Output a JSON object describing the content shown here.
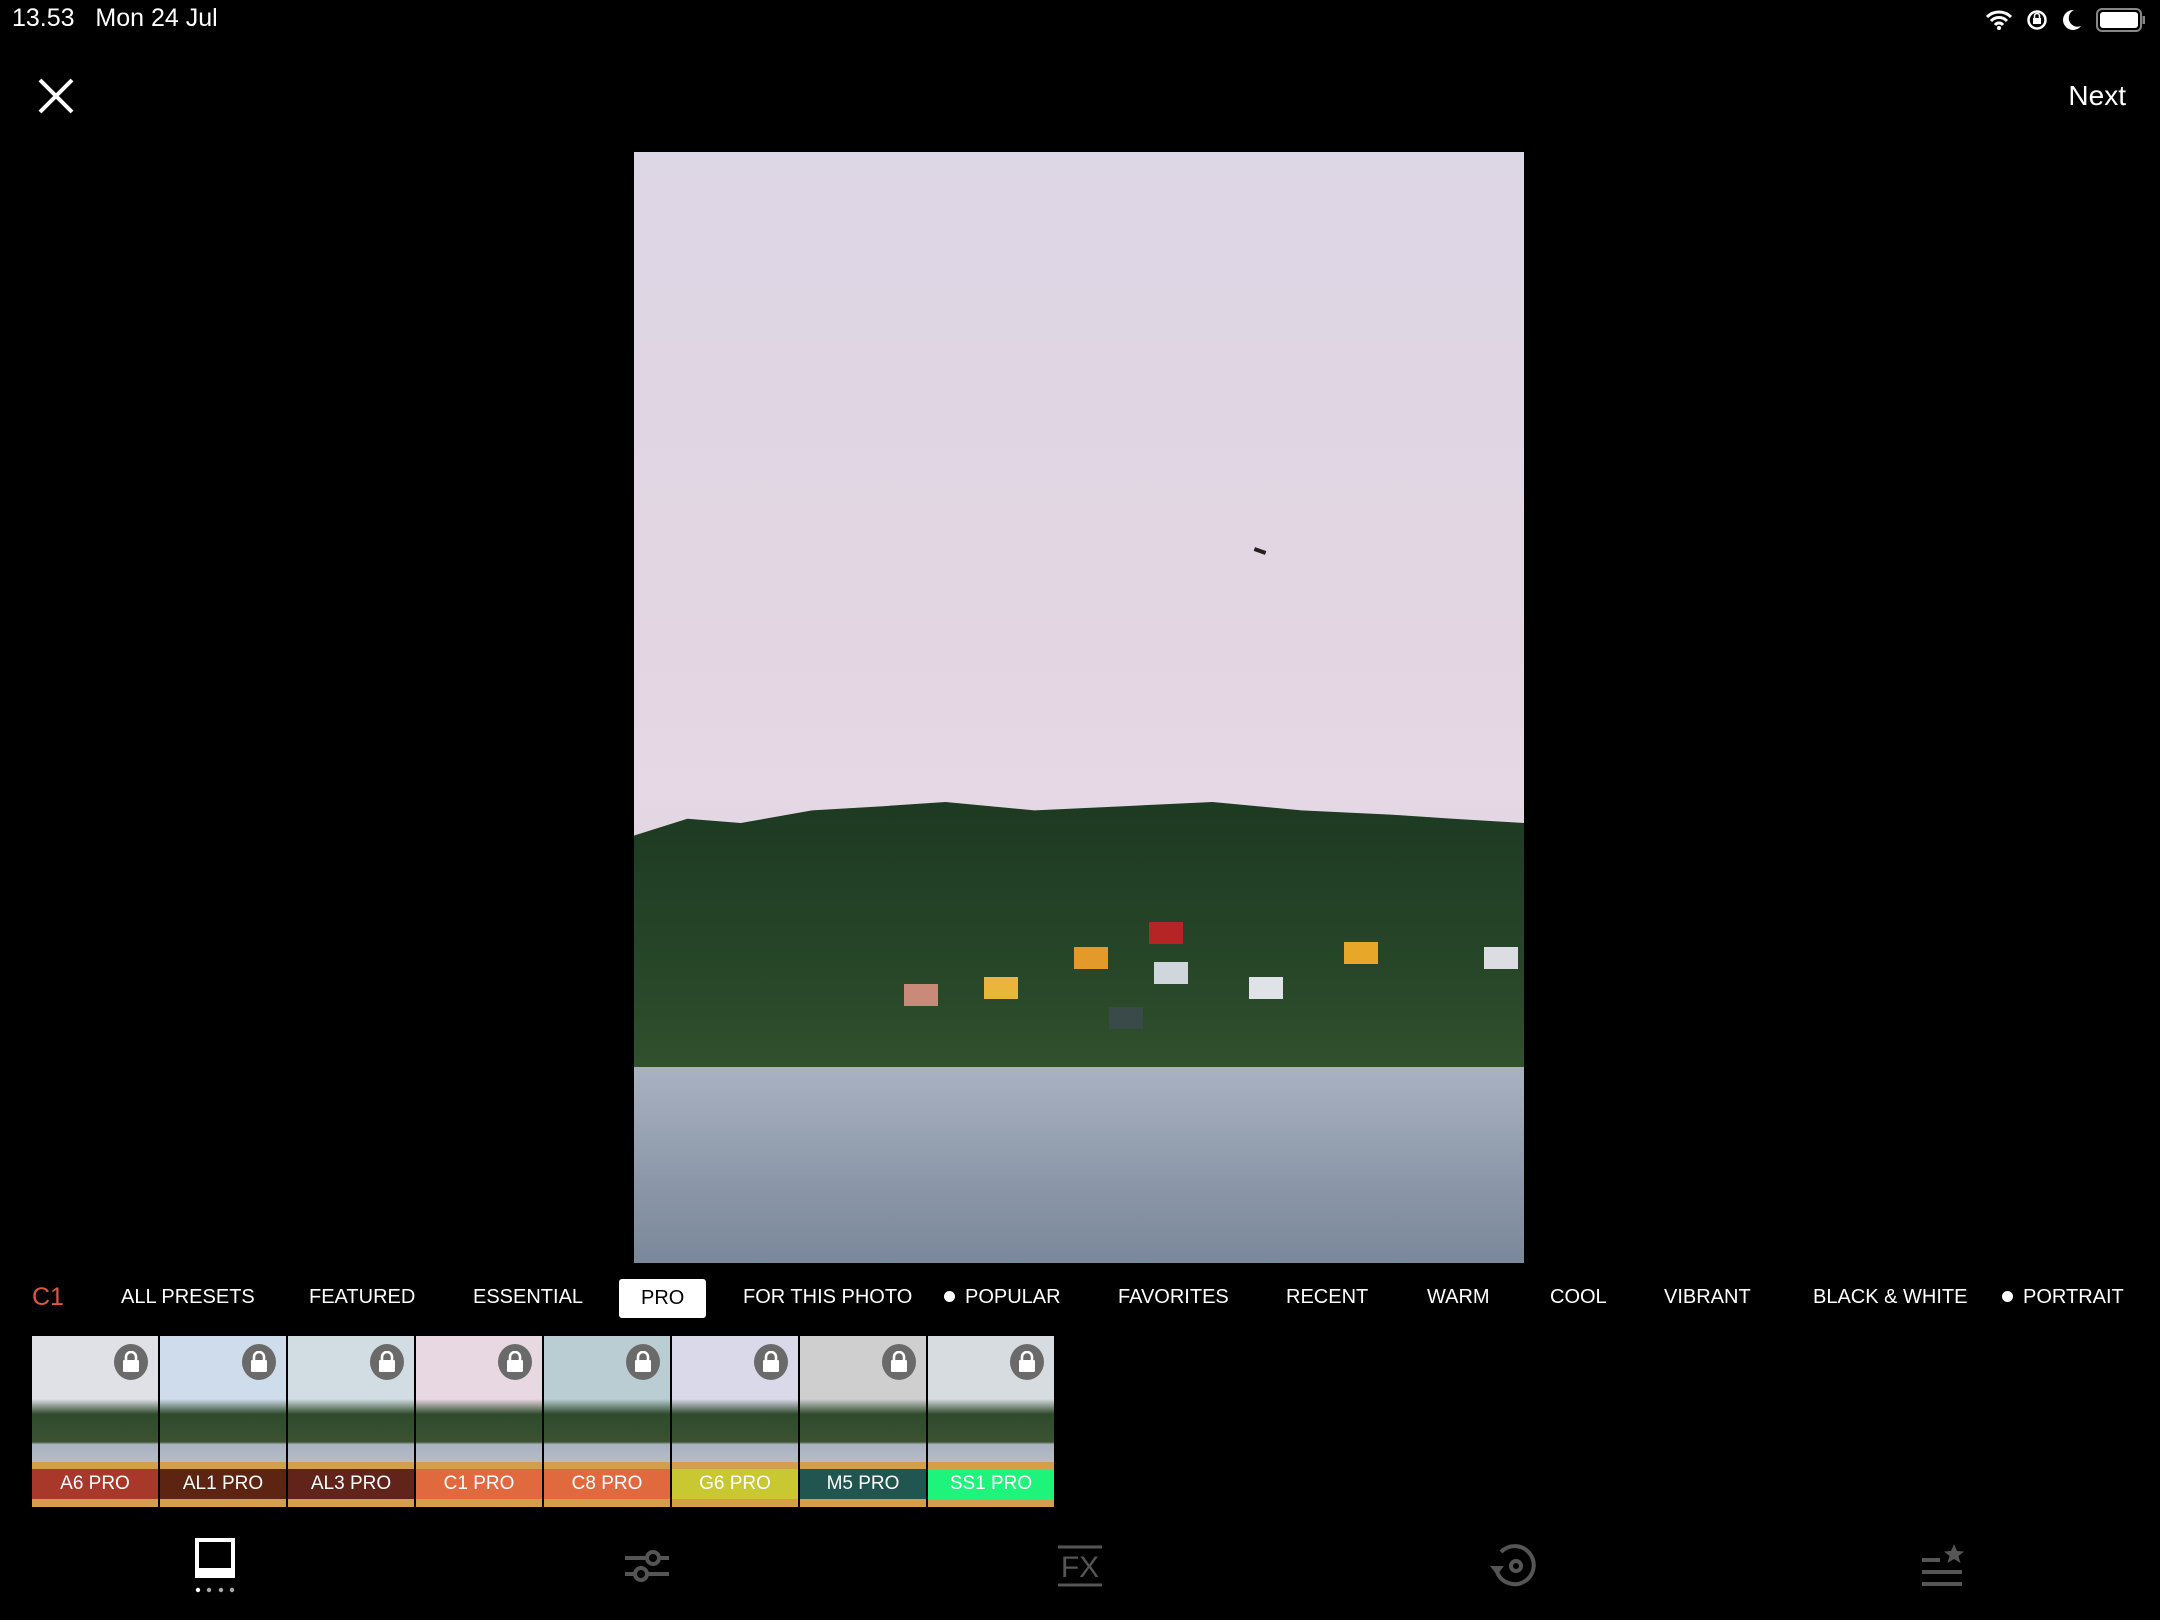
{
  "status_bar": {
    "time": "13.53",
    "date": "Mon 24 Jul",
    "icons": [
      "wifi-icon",
      "rotation-lock-icon",
      "moon-icon",
      "battery-icon"
    ]
  },
  "header": {
    "close_icon": "close-icon",
    "next_label": "Next"
  },
  "categories": {
    "current_preset": "C1",
    "items": [
      {
        "label": "ALL PRESETS"
      },
      {
        "label": "FEATURED"
      },
      {
        "label": "ESSENTIAL"
      },
      {
        "label": "PRO",
        "selected": true
      },
      {
        "label": "FOR THIS PHOTO"
      },
      {
        "label": "POPULAR",
        "dot": true
      },
      {
        "label": "FAVORITES"
      },
      {
        "label": "RECENT"
      },
      {
        "label": "WARM"
      },
      {
        "label": "COOL"
      },
      {
        "label": "VIBRANT"
      },
      {
        "label": "BLACK & WHITE"
      },
      {
        "label": "PORTRAIT",
        "dot": true
      }
    ]
  },
  "presets": [
    {
      "label": "A6 PRO",
      "color": "#a8392a",
      "sky": "#dfe1e6",
      "locked": true
    },
    {
      "label": "AL1 PRO",
      "color": "#5e2412",
      "sky": "#cfdcec",
      "locked": true
    },
    {
      "label": "AL3 PRO",
      "color": "#62241a",
      "sky": "#d2dde3",
      "locked": true
    },
    {
      "label": "C1 PRO",
      "color": "#e0693d",
      "sky": "#e8d8e2",
      "locked": true
    },
    {
      "label": "C8 PRO",
      "color": "#e0693d",
      "sky": "#b9cdd3",
      "locked": true
    },
    {
      "label": "G6 PRO",
      "color": "#c9c832",
      "sky": "#dad9ea",
      "locked": true
    },
    {
      "label": "M5 PRO",
      "color": "#215650",
      "sky": "#cfcfcf",
      "locked": true
    },
    {
      "label": "SS1 PRO",
      "color": "#1ef37b",
      "sky": "#d6dcdf",
      "locked": true
    }
  ],
  "toolbar": [
    {
      "name": "presets-icon",
      "active": true
    },
    {
      "name": "adjust-sliders-icon"
    },
    {
      "name": "fx-icon",
      "label": "FX"
    },
    {
      "name": "recipes-history-icon"
    },
    {
      "name": "favorites-list-icon"
    }
  ],
  "colors": {
    "accent": "#e0563e",
    "inactive_icon": "#555555"
  }
}
